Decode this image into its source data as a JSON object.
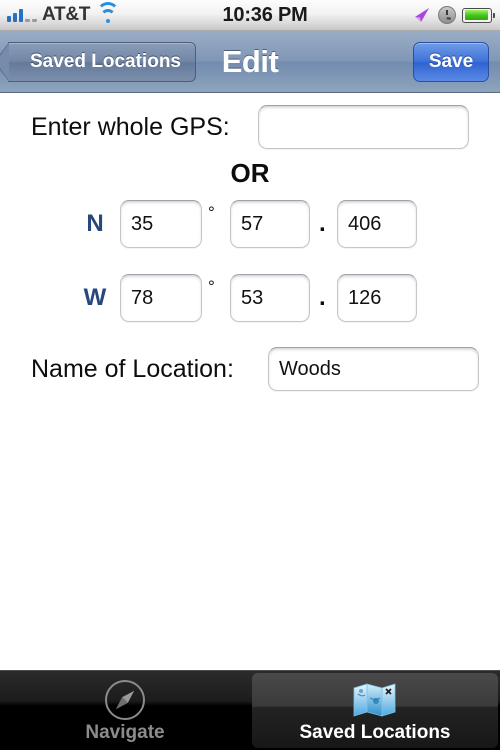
{
  "status_bar": {
    "signal_icon": "signal-bars-icon",
    "signal_bars_filled": 3,
    "signal_bars_empty": 2,
    "carrier": "AT&T",
    "wifi_icon": "wifi-icon",
    "time": "10:36 PM",
    "location_icon": "location-arrow-icon",
    "alarm_icon": "alarm-clock-icon",
    "battery_icon": "battery-icon",
    "battery_level": 94,
    "colors": {
      "signal": "#2b6fc4",
      "wifi": "#2b8fe0",
      "location_arrow": "#b44ce0",
      "battery_fill": "#43c417"
    }
  },
  "nav_bar": {
    "back_label": "Saved Locations",
    "title": "Edit",
    "save_label": "Save",
    "colors": {
      "bar": "#8097b6",
      "save_button": "#3f72d8"
    }
  },
  "form": {
    "gps": {
      "label": "Enter whole GPS:",
      "value": "",
      "placeholder": ""
    },
    "divider_text": "OR",
    "coordinates": [
      {
        "direction": "N",
        "degrees": "35",
        "degree_symbol": "°",
        "minutes": "57",
        "decimal_separator": ".",
        "decimal": "406"
      },
      {
        "direction": "W",
        "degrees": "78",
        "degree_symbol": "°",
        "minutes": "53",
        "decimal_separator": ".",
        "decimal": "126"
      }
    ],
    "name": {
      "label": "Name of Location:",
      "value": "Woods",
      "placeholder": ""
    },
    "colors": {
      "direction_label": "#27487c"
    }
  },
  "tab_bar": {
    "tabs": [
      {
        "label": "Navigate",
        "icon": "compass-icon",
        "selected": false
      },
      {
        "label": "Saved Locations",
        "icon": "map-icon",
        "selected": true
      }
    ]
  }
}
